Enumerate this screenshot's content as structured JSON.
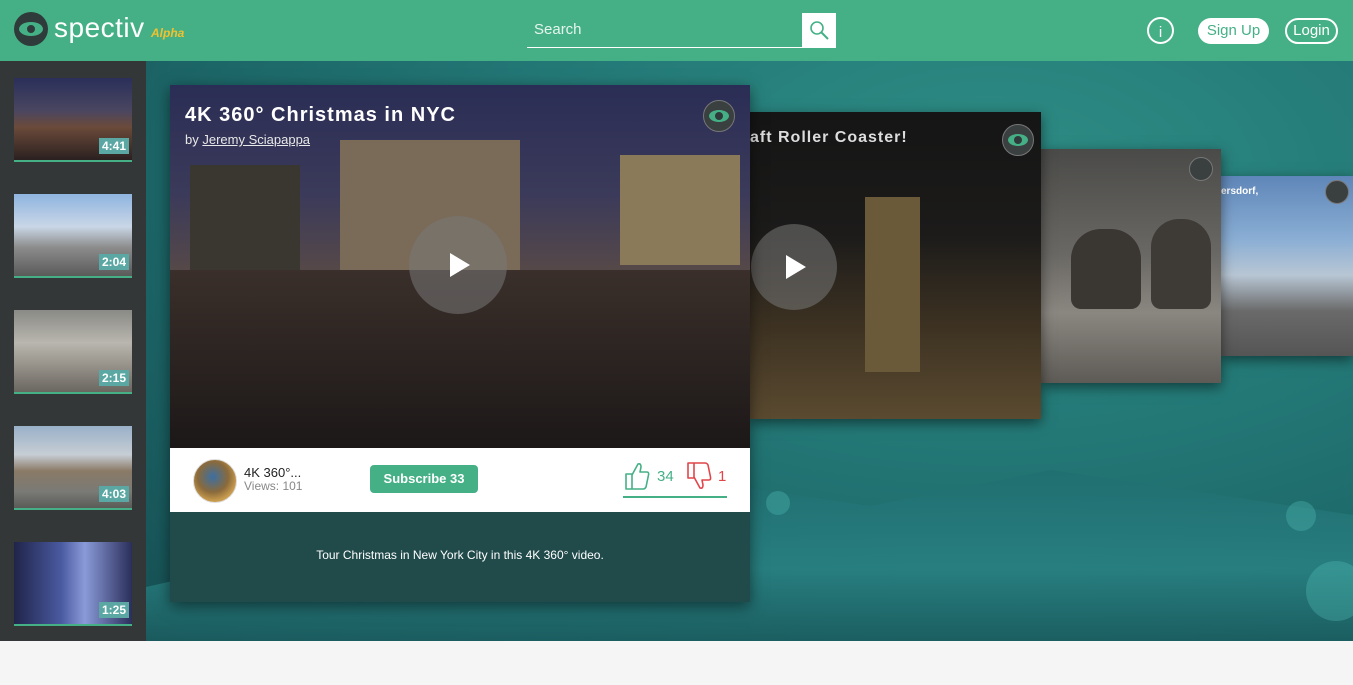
{
  "header": {
    "brand": "spectiv",
    "brand_sub": "Alpha",
    "search_placeholder": "Search",
    "info_label": "i",
    "signup_label": "Sign Up",
    "login_label": "Login"
  },
  "sidebar": {
    "items": [
      {
        "duration": "4:41"
      },
      {
        "duration": "2:04"
      },
      {
        "duration": "2:15"
      },
      {
        "duration": "4:03"
      },
      {
        "duration": "1:25"
      }
    ]
  },
  "featured": {
    "title": "4K 360° Christmas in NYC",
    "by_prefix": "by",
    "author": "Jeremy Sciapappa",
    "short_title": "4K 360°...",
    "views": "Views: 101",
    "subscribe_label": "Subscribe 33",
    "likes": "34",
    "dislikes": "1",
    "description": "Tour Christmas in New York City in this 4K 360° video."
  },
  "carousel": {
    "card2_title": "aft Roller Coaster!",
    "card4_title": "ersdorf,"
  },
  "colors": {
    "accent": "#45b086",
    "sidebar": "#333738",
    "dislike": "#e0454a",
    "brand_sub": "#f2c12e"
  },
  "icons": {
    "logo": "eye-logo-icon",
    "search": "magnifier-icon",
    "play": "play-icon",
    "like": "thumbs-up-icon",
    "dislike": "thumbs-down-icon"
  }
}
